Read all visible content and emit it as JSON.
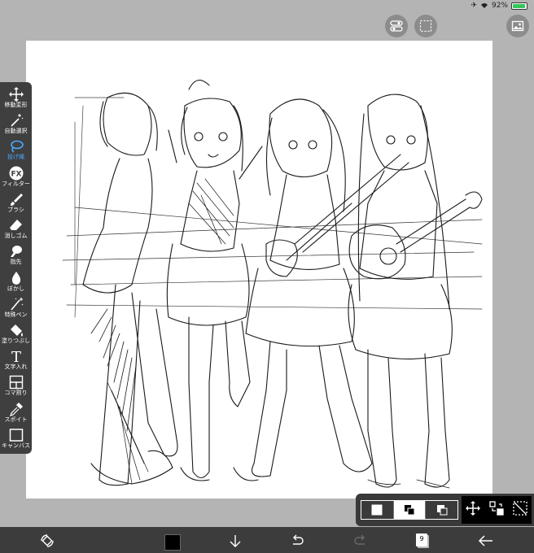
{
  "status_bar": {
    "battery_text": "92%",
    "battery_level": 0.92,
    "icons": [
      "airplane-icon",
      "wifi-icon",
      "battery-icon"
    ]
  },
  "top_buttons": [
    "toggle-icon",
    "selection-icon",
    "image-icon"
  ],
  "toolbar": {
    "active_tool": "lasso",
    "tools": [
      {
        "id": "move",
        "label": "移動変形",
        "icon": "move-arrows-icon"
      },
      {
        "id": "magic",
        "label": "自動選択",
        "icon": "magic-wand-icon"
      },
      {
        "id": "lasso",
        "label": "投げ縄",
        "icon": "lasso-icon"
      },
      {
        "id": "filter",
        "label": "フィルター",
        "icon": "fx-icon",
        "icon_text": "FX"
      },
      {
        "id": "brush",
        "label": "ブラシ",
        "icon": "brush-icon"
      },
      {
        "id": "eraser",
        "label": "消しゴム",
        "icon": "eraser-icon"
      },
      {
        "id": "finger",
        "label": "指先",
        "icon": "finger-icon"
      },
      {
        "id": "blur",
        "label": "ぼかし",
        "icon": "drop-icon"
      },
      {
        "id": "special",
        "label": "特殊ペン",
        "icon": "special-pen-icon"
      },
      {
        "id": "fill",
        "label": "塗りつぶし",
        "icon": "fill-bucket-icon"
      },
      {
        "id": "text",
        "label": "文字入れ",
        "icon": "text-icon",
        "icon_text": "T"
      },
      {
        "id": "panel",
        "label": "コマ割り",
        "icon": "panel-icon"
      },
      {
        "id": "eyedropper",
        "label": "スポイト",
        "icon": "eyedropper-icon"
      },
      {
        "id": "canvas",
        "label": "キャンバス",
        "icon": "canvas-icon"
      }
    ]
  },
  "selection_modes": [
    "new-selection-icon",
    "add-selection-icon",
    "subtract-selection-icon"
  ],
  "selection_active": 1,
  "transform_buttons": [
    "move-arrows-icon",
    "transform-icon",
    "deselect-icon"
  ],
  "bottom_bar": {
    "current_color": "#000000",
    "layer_count": "9",
    "icons": [
      "rotate-icon",
      "color-swatch",
      "download-icon",
      "undo-icon",
      "redo-icon",
      "layers-icon",
      "back-icon"
    ]
  },
  "colors": {
    "toolbar_bg": "#3f3f3f",
    "accent": "#4aa8ff",
    "background": "#b4b4b4"
  }
}
